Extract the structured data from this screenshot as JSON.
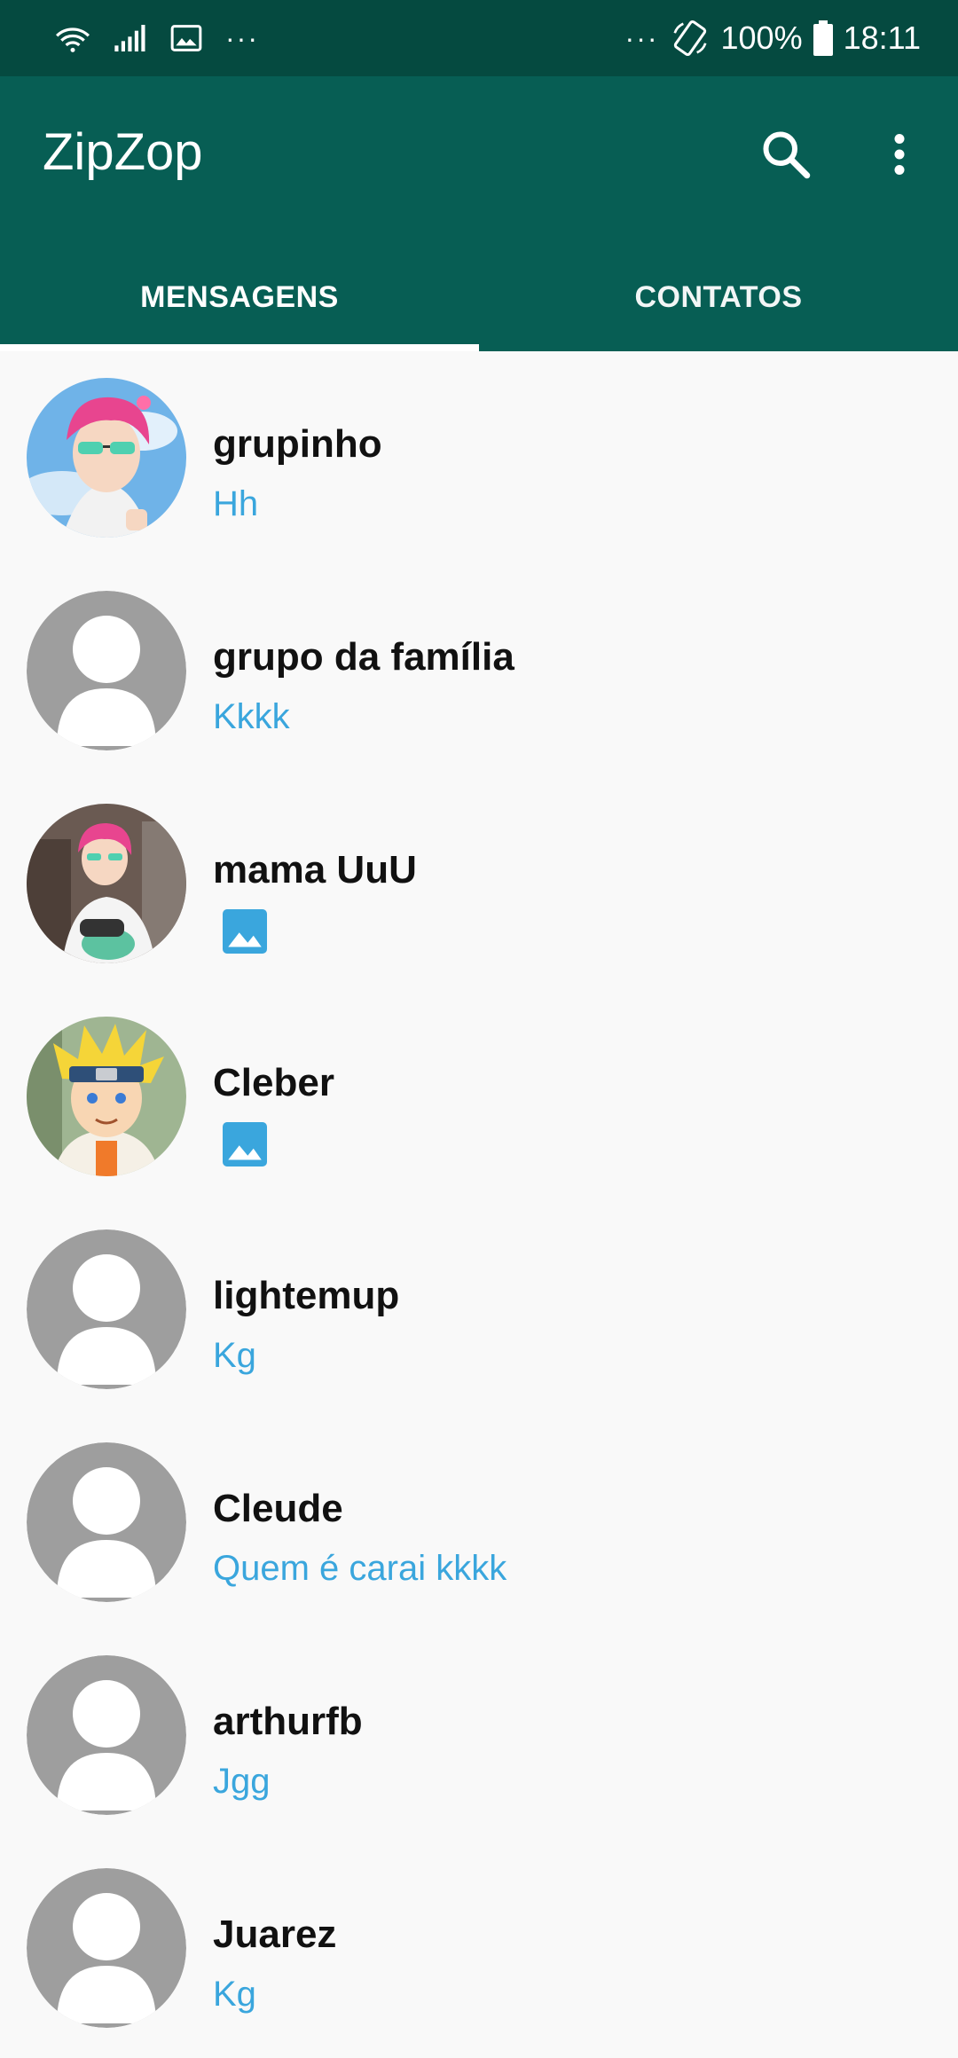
{
  "status_bar": {
    "left_dots": "···",
    "right_dots": "···",
    "battery": "100%",
    "time": "18:11"
  },
  "app_bar": {
    "title": "ZipZop",
    "search_icon": "search-icon",
    "menu_icon": "more-vert-icon"
  },
  "tabs": [
    {
      "label": "MENSAGENS",
      "active": true
    },
    {
      "label": "CONTATOS",
      "active": false
    }
  ],
  "conversations": [
    {
      "name": "grupinho",
      "last_message": "Hh",
      "avatar": "anime-pink-hair-glasses",
      "message_type": "text"
    },
    {
      "name": "grupo da família",
      "last_message": "Kkkk",
      "avatar": "default-person",
      "message_type": "text"
    },
    {
      "name": "mama UuU",
      "last_message": "",
      "avatar": "anime-pink-hair-white-shirt",
      "message_type": "image"
    },
    {
      "name": "Cleber",
      "last_message": "",
      "avatar": "anime-blond-headband",
      "message_type": "image"
    },
    {
      "name": "lightemup",
      "last_message": "Kg",
      "avatar": "default-person",
      "message_type": "text"
    },
    {
      "name": "Cleude",
      "last_message": "Quem é carai kkkk",
      "avatar": "default-person",
      "message_type": "text"
    },
    {
      "name": "arthurfb",
      "last_message": "Jgg",
      "avatar": "default-person",
      "message_type": "text"
    },
    {
      "name": "Juarez",
      "last_message": "Kg",
      "avatar": "default-person",
      "message_type": "text"
    }
  ],
  "colors": {
    "status_bar": "#054a40",
    "app_bar": "#075e54",
    "message_text": "#3aa6dd",
    "default_avatar": "#9e9e9e"
  }
}
